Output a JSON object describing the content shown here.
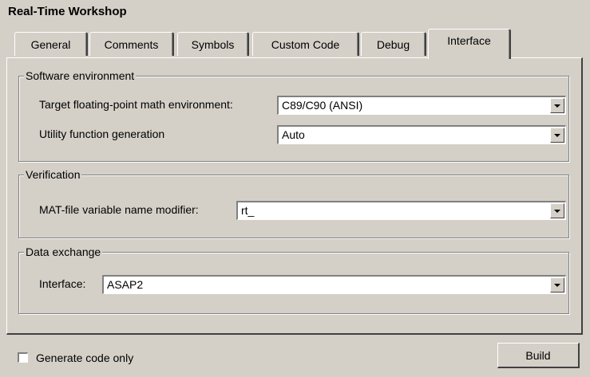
{
  "window": {
    "title": "Real-Time Workshop"
  },
  "tabs": [
    {
      "label": "General"
    },
    {
      "label": "Comments"
    },
    {
      "label": "Symbols"
    },
    {
      "label": "Custom Code"
    },
    {
      "label": "Debug"
    },
    {
      "label": "Interface",
      "active": true
    }
  ],
  "software_environment": {
    "legend": "Software environment",
    "math_env_label": "Target floating-point math environment:",
    "math_env_value": "C89/C90 (ANSI)",
    "utility_label": "Utility function generation",
    "utility_value": "Auto"
  },
  "verification": {
    "legend": "Verification",
    "mat_label": "MAT-file variable name modifier:",
    "mat_value": "rt_"
  },
  "data_exchange": {
    "legend": "Data exchange",
    "interface_label": "Interface:",
    "interface_value": "ASAP2"
  },
  "footer": {
    "generate_code_only_label": "Generate code only",
    "generate_code_only_checked": false,
    "build_label": "Build"
  },
  "icons": {
    "dropdown": "chevron-down-icon"
  }
}
